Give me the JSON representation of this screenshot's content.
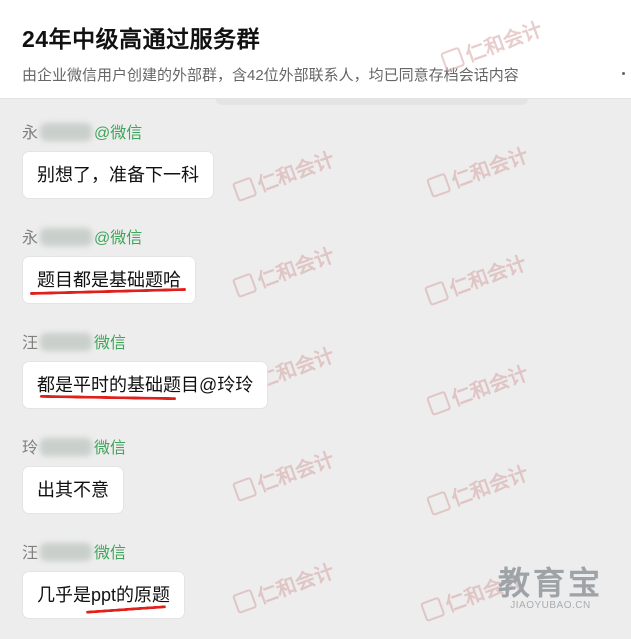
{
  "header": {
    "title": "24年中级高通过服务群",
    "subtitle": "由企业微信用户创建的外部群，含42位外部联系人，均已同意存档会话内容"
  },
  "messages": [
    {
      "sender_name": "永",
      "sender_at": "@",
      "sender_source": "微信",
      "text": "别想了，准备下一科"
    },
    {
      "sender_name": "永",
      "sender_at": "@",
      "sender_source": "微信",
      "text": "题目都是基础题哈"
    },
    {
      "sender_name": "汪",
      "sender_at": "",
      "sender_source": "微信",
      "text": "都是平时的基础题目@玲玲"
    },
    {
      "sender_name": "玲",
      "sender_at": "",
      "sender_source": "微信",
      "text": "出其不意"
    },
    {
      "sender_name": "汪",
      "sender_at": "",
      "sender_source": "微信",
      "text": "几乎是ppt的原题"
    }
  ],
  "watermark": {
    "text": "仁和会计"
  },
  "corner_mark": {
    "text": "教育宝",
    "url": "JIAOYUBAO.CN"
  },
  "colors": {
    "source_green": "#3fa55a",
    "underline_red": "#e0211b",
    "background": "#ededed"
  }
}
